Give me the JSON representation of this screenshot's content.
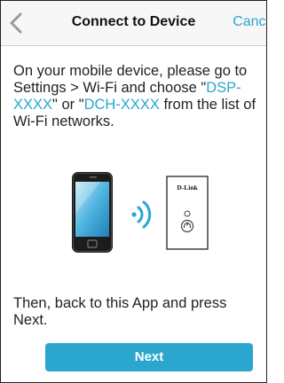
{
  "nav": {
    "title": "Connect to Device",
    "cancel_label": "Cancel"
  },
  "instruction": {
    "part1": "On your mobile device, please go to Settings > Wi-Fi and choose \"",
    "ssid1": "DSP-XXXX",
    "part2": "\" or \"",
    "ssid2": "DCH-XXXX",
    "part3": " from the list of Wi-Fi networks."
  },
  "illustration": {
    "device_brand": "D-Link",
    "phone_icon": "smartphone-icon",
    "signal_icon": "wifi-signal-icon",
    "device_icon": "dlink-plug-icon"
  },
  "after_text": "Then, back to this App and press Next.",
  "next_label": "Next",
  "colors": {
    "accent": "#2aa6cf",
    "text": "#222222",
    "nav_bg": "#f7f7f7"
  }
}
